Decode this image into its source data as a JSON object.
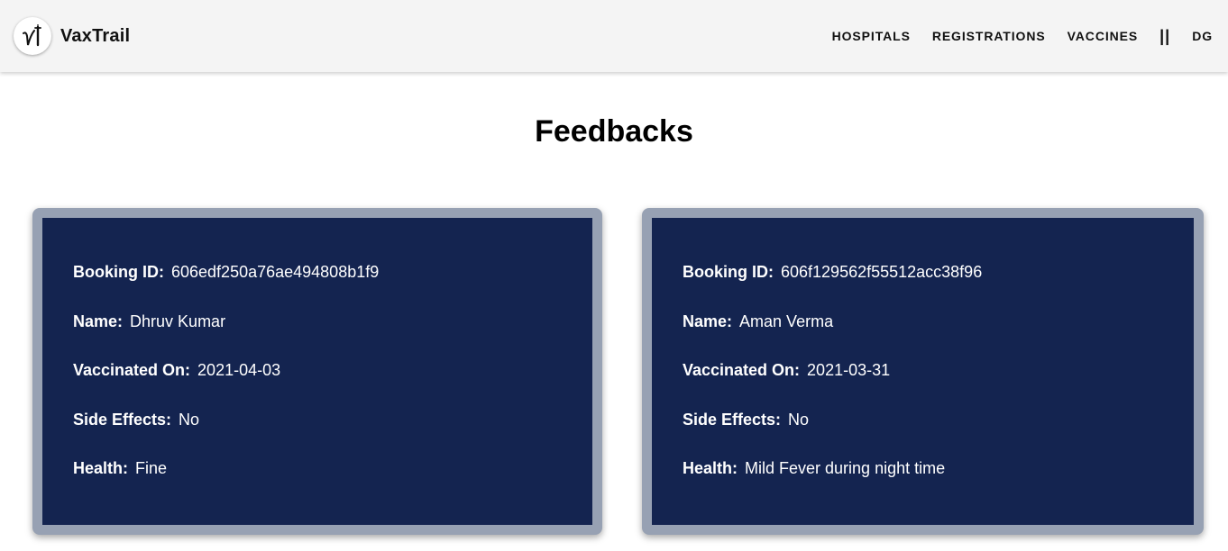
{
  "navbar": {
    "brand": "VaxTrail",
    "logo_icon": "vaccine-syringe-logo",
    "links": [
      "HOSPITALS",
      "REGISTRATIONS",
      "VACCINES"
    ],
    "separator": "||",
    "user_initials": "DG"
  },
  "page": {
    "title": "Feedbacks"
  },
  "labels": {
    "booking_id": "Booking ID:",
    "name": "Name:",
    "vaccinated_on": "Vaccinated On:",
    "side_effects": "Side Effects:",
    "health": "Health:"
  },
  "feedbacks": [
    {
      "booking_id": "606edf250a76ae494808b1f9",
      "name": "Dhruv Kumar",
      "vaccinated_on": "2021-04-03",
      "side_effects": "No",
      "health": "Fine"
    },
    {
      "booking_id": "606f129562f55512acc38f96",
      "name": "Aman Verma",
      "vaccinated_on": "2021-03-31",
      "side_effects": "No",
      "health": "Mild Fever during night time"
    }
  ],
  "colors": {
    "card_border": "#97a1b3",
    "card_background": "#142450",
    "navbar_background": "#f4f4f4"
  }
}
